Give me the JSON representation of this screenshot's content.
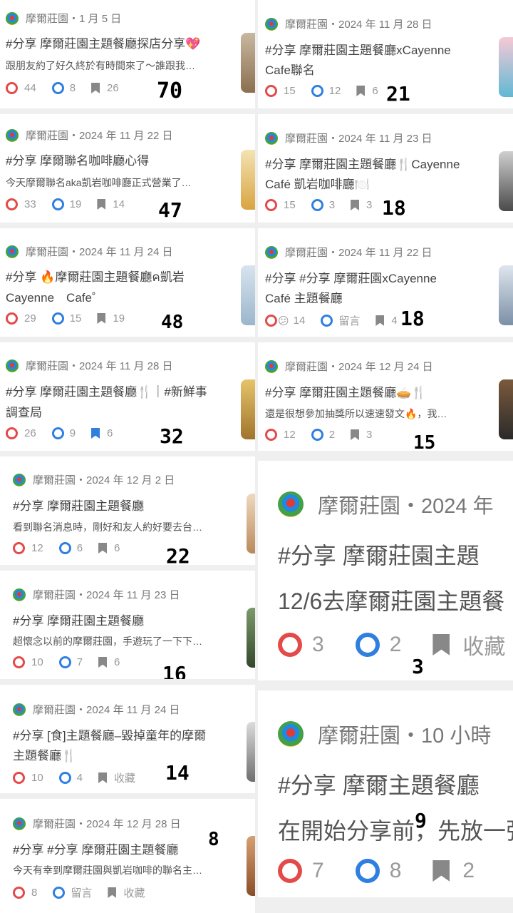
{
  "author": "摩爾莊園",
  "left": [
    {
      "date": "1 月 5 日",
      "title": "#分享 摩爾莊園主題餐廳探店分享💖",
      "title2": "",
      "snippet": "跟朋友約了好久終於有時間來了～誰跟我…",
      "likes": "44",
      "comments": "8",
      "saves": "26",
      "overlay": "70"
    },
    {
      "date": "2024 年 11 月 22 日",
      "title": "#分享 摩爾聯名咖啡廳心得",
      "title2": "",
      "snippet": "今天摩爾聯名aka凱岩咖啡廳正式營業了…",
      "likes": "33",
      "comments": "19",
      "saves": "14",
      "overlay": "47"
    },
    {
      "date": "2024 年 11 月 24 日",
      "title": "#分享 🔥摩爾莊園主題餐廳ค凱岩",
      "title2": "Cayenne　Cafe˚",
      "snippet": "",
      "likes": "29",
      "comments": "15",
      "saves": "19",
      "overlay": "48"
    },
    {
      "date": "2024 年 11 月 28 日",
      "title": "#分享 摩爾莊園主題餐廳🍴｜#新鮮事",
      "title2": "調查局",
      "snippet": "",
      "likes": "26",
      "comments": "9",
      "saves": "6",
      "overlay": "32"
    },
    {
      "date": "2024 年 12 月 2 日",
      "title": "#分享 摩爾莊園主題餐廳",
      "title2": "",
      "snippet": "看到聯名消息時，剛好和友人約好要去台…",
      "likes": "12",
      "comments": "6",
      "saves": "6",
      "overlay": "22"
    },
    {
      "date": "2024 年 11 月 23 日",
      "title": "#分享 摩爾莊園主題餐廳",
      "title2": "",
      "snippet": "超懷念以前的摩爾莊園，手遊玩了一下下…",
      "likes": "10",
      "comments": "7",
      "saves": "6",
      "overlay": "16"
    },
    {
      "date": "2024 年 11 月 24 日",
      "title": "#分享 [食]主題餐廳–毀掉童年的摩爾",
      "title2": "主題餐廳🍴",
      "snippet": "",
      "likes": "10",
      "comments": "4",
      "saves": "收藏",
      "overlay": "14"
    },
    {
      "date": "2024 年 12 月 28 日",
      "title": "#分享 #分享 摩爾莊園主題餐廳",
      "title2": "",
      "snippet": "今天有幸到摩爾莊園與凱岩咖啡的聯名主…",
      "likes": "8",
      "comments": "留言",
      "saves": "收藏",
      "overlay": "8"
    }
  ],
  "right": [
    {
      "date": "2024 年 11 月 28 日",
      "title": "#分享 摩爾莊園主題餐廳xCayenne",
      "title2": "Cafe聯名",
      "snippet": "",
      "likes": "15",
      "comments": "12",
      "saves": "6",
      "overlay": "21"
    },
    {
      "date": "2024 年 11 月 23 日",
      "title": "#分享 摩爾莊園主題餐廳🍴Cayenne",
      "title2": "Café 凱岩咖啡廳🍽️",
      "snippet": "",
      "likes": "15",
      "comments": "3",
      "saves": "3",
      "overlay": "18"
    },
    {
      "date": "2024 年 11 月 22 日",
      "title": "#分享 #分享 摩爾莊園xCayenne",
      "title2": "Café 主題餐廳",
      "snippet": "",
      "likes": "14",
      "comments": "留言",
      "saves": "4",
      "overlay": "18"
    },
    {
      "date": "2024 年 12 月 24 日",
      "title": "#分享 摩爾莊園主題餐廳🥧🍴",
      "title2": "",
      "snippet": "還是很想參加抽獎所以速速發文🔥，我…",
      "likes": "12",
      "comments": "2",
      "saves": "3",
      "overlay": "15"
    }
  ],
  "large": [
    {
      "date": "2024 年",
      "title": "#分享 摩爾莊園主題",
      "snippet": "12/6去摩爾莊園主題餐",
      "likes": "3",
      "comments": "2",
      "saves": "收藏",
      "overlay": "3"
    },
    {
      "date": "10 小時",
      "title": "#分享 摩爾主題餐廳",
      "snippet": "在開始分享前，先放一張",
      "likes": "7",
      "comments": "8",
      "saves": "2",
      "overlay": "9"
    }
  ],
  "colors": {
    "like": "#e34a4a",
    "comment": "#2f7fe0",
    "save": "#888888"
  }
}
